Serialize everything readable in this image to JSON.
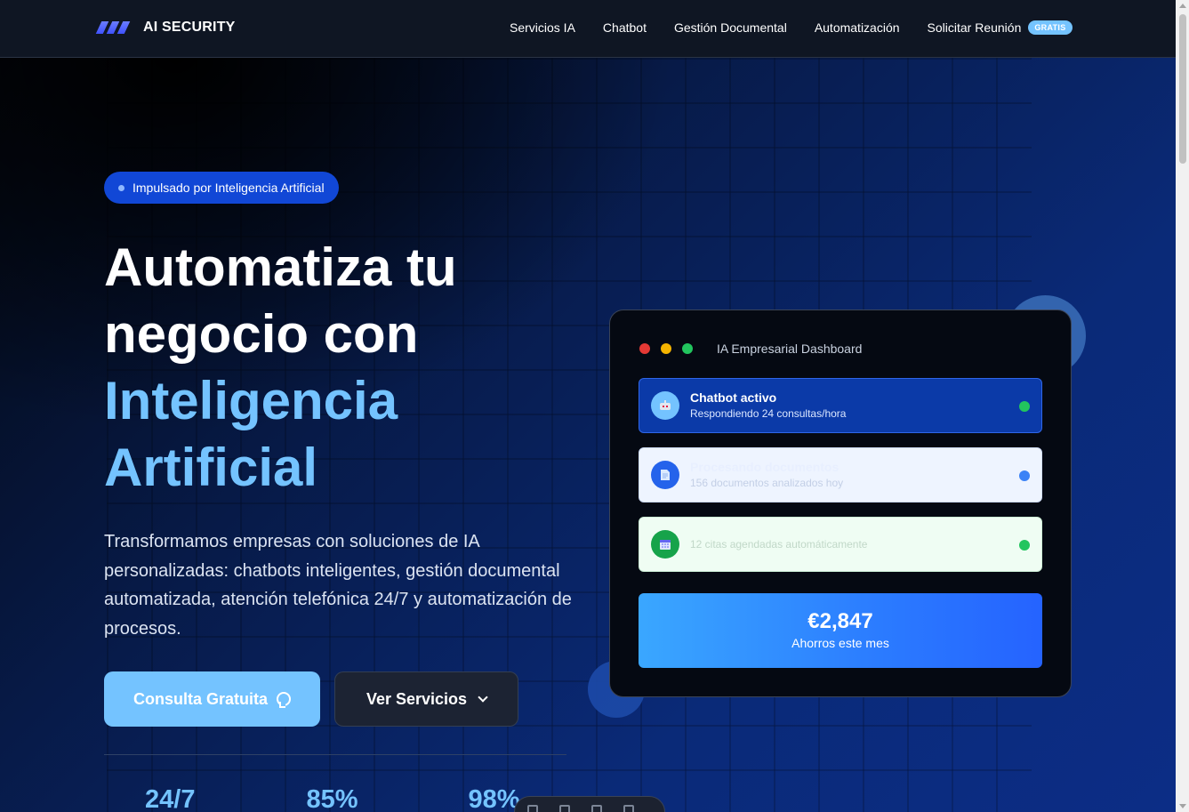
{
  "brand": {
    "name": "AI SECURITY",
    "logo_icon": "slanted-bars-logo"
  },
  "nav": {
    "items": [
      "Servicios IA",
      "Chatbot",
      "Gestión Documental",
      "Automatización",
      "Solicitar Reunión"
    ],
    "badge": "GRATIS"
  },
  "hero": {
    "pill": "Impulsado por Inteligencia Artificial",
    "headline_line1": "Automatiza tu",
    "headline_line2": "negocio con",
    "headline_line3": "Inteligencia",
    "headline_line4": "Artificial",
    "description": "Transformamos empresas con soluciones de IA personalizadas: chatbots inteligentes, gestión documental automatizada, atención telefónica 24/7 y automatización de procesos.",
    "primary_button": "Consulta Gratuita",
    "secondary_button": "Ver Servicios",
    "stats": [
      "24/7",
      "85%",
      "98%"
    ]
  },
  "dashboard": {
    "title": "IA Empresarial Dashboard",
    "window_dots": [
      "#e53935",
      "#f5b400",
      "#22c55e"
    ],
    "rows": [
      {
        "icon": "robot-icon",
        "title": "Chatbot activo",
        "subtitle": "Respondiendo 24 consultas/hora",
        "status_color": "#22c55e"
      },
      {
        "icon": "document-icon",
        "title": "Procesando documentos",
        "subtitle": "156 documentos analizados hoy",
        "status_color": "#3b82f6"
      },
      {
        "icon": "calendar-icon",
        "title": "",
        "subtitle": "12 citas agendadas automáticamente",
        "status_color": "#22c55e"
      }
    ],
    "savings_amount": "€2,847",
    "savings_label": "Ahorros este mes"
  },
  "colors": {
    "accent": "#74c3ff",
    "pill_bg": "#1147d6",
    "card_bg": "#050912"
  }
}
